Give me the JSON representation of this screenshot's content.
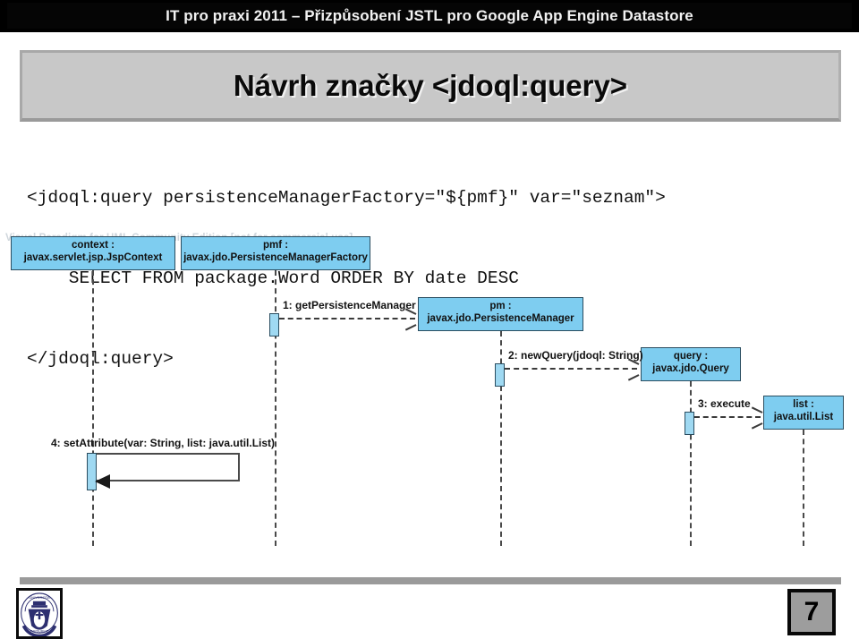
{
  "banner": {
    "title": "IT pro praxi 2011 – Přizpůsobení JSTL pro Google App Engine Datastore"
  },
  "slide": {
    "title": "Návrh značky <jdoql:query>",
    "page_number": "7"
  },
  "code": {
    "line1": "<jdoql:query persistenceManagerFactory=\"${pmf}\" var=\"seznam\">",
    "line2": "    SELECT FROM package.Word ORDER BY date DESC",
    "line3": "</jdoql:query>"
  },
  "diagram": {
    "watermark": "Visual Paradigm for UML Community Edition [not for commercial use]",
    "lifelines": [
      {
        "name": "context :",
        "type": "javax.servlet.jsp.JspContext"
      },
      {
        "name": "pmf :",
        "type": "javax.jdo.PersistenceManagerFactory"
      },
      {
        "name": "pm :",
        "type": "javax.jdo.PersistenceManager"
      },
      {
        "name": "query :",
        "type": "javax.jdo.Query"
      },
      {
        "name": "list :",
        "type": "java.util.List"
      }
    ],
    "messages": [
      {
        "label": "1: getPersistenceManager"
      },
      {
        "label": "2: newQuery(jdoql: String)"
      },
      {
        "label": "3: execute"
      },
      {
        "label": "4: setAttribute(var: String, list: java.util.List)"
      }
    ]
  },
  "colors": {
    "lifeline_fill": "#7ecdf0",
    "lifeline_border": "#2a4d60",
    "banner_bg": "#000000",
    "title_panel_bg": "#c8c8c8",
    "logo_navy": "#2d2f70"
  }
}
